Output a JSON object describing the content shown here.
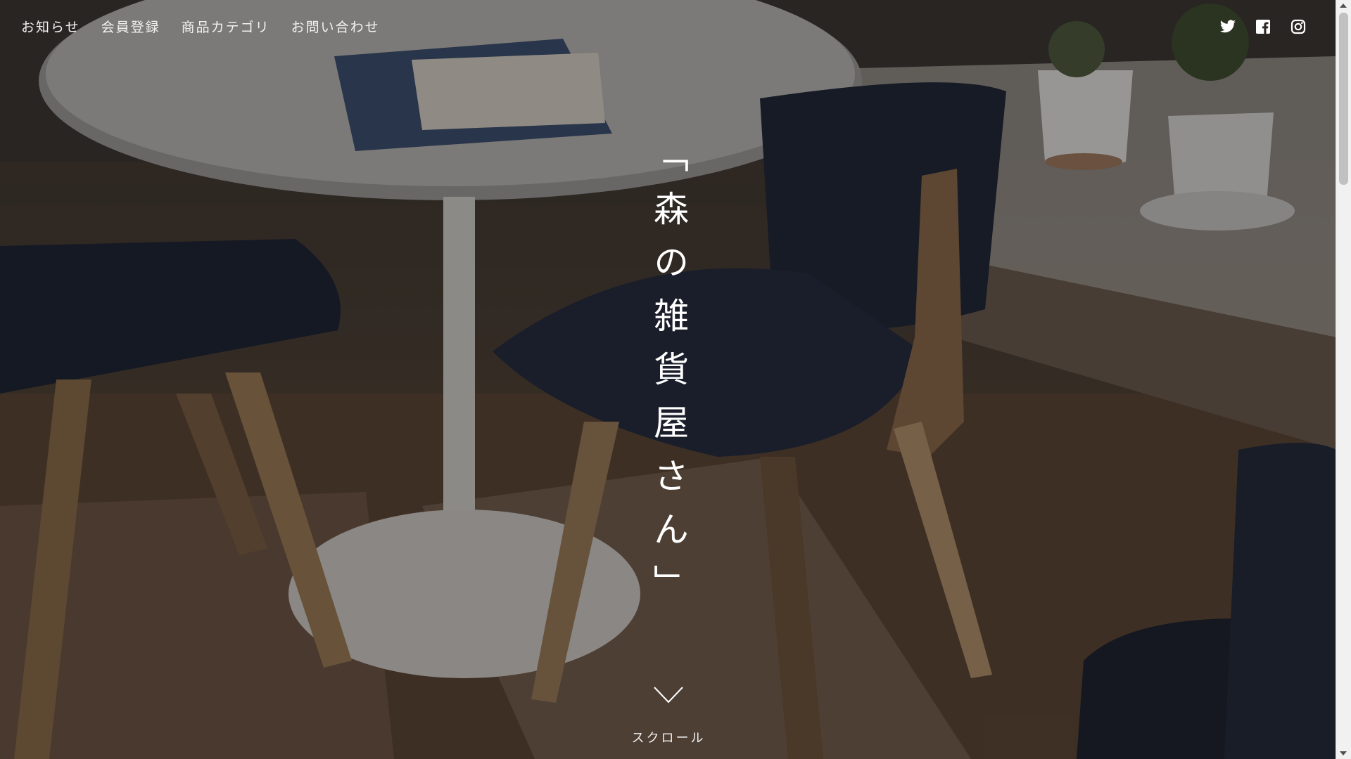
{
  "nav": {
    "items": [
      {
        "label": "お知らせ"
      },
      {
        "label": "会員登録"
      },
      {
        "label": "商品カテゴリ"
      },
      {
        "label": "お問い合わせ"
      }
    ]
  },
  "social": {
    "icons": [
      "twitter-icon",
      "facebook-icon",
      "instagram-icon"
    ],
    "color": "#ffffff"
  },
  "hero": {
    "title": "「森の雑貨屋さん」",
    "scroll_label": "スクロール"
  }
}
